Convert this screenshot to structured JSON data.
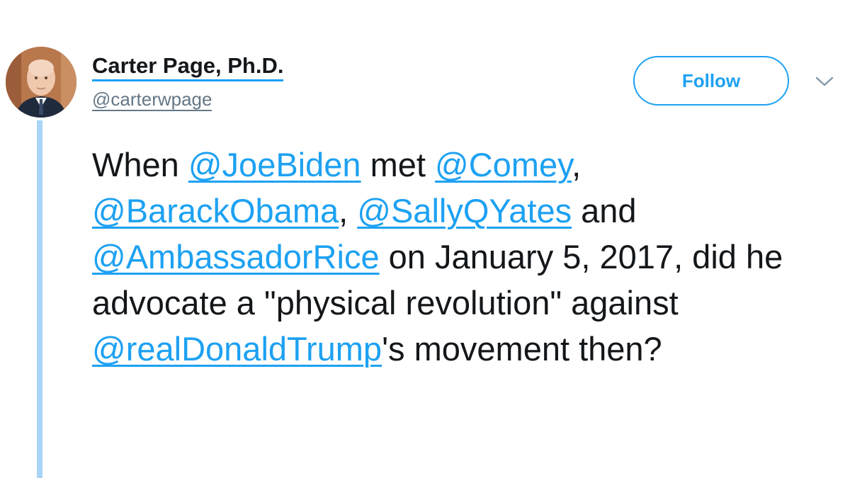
{
  "author": {
    "name": "Carter Page, Ph.D.",
    "handle": "@carterwpage"
  },
  "actions": {
    "follow_label": "Follow",
    "menu_icon": "chevron-down-icon"
  },
  "tweet": {
    "segments": [
      {
        "text": "When ",
        "mention": false
      },
      {
        "text": "@JoeBiden",
        "mention": true
      },
      {
        "text": " met ",
        "mention": false
      },
      {
        "text": "@Comey",
        "mention": true
      },
      {
        "text": ", ",
        "mention": false
      },
      {
        "text": "@BarackObama",
        "mention": true
      },
      {
        "text": ", ",
        "mention": false
      },
      {
        "text": "@SallyQYates",
        "mention": true
      },
      {
        "text": " and ",
        "mention": false
      },
      {
        "text": "@AmbassadorRice",
        "mention": true
      },
      {
        "text": " on January 5, 2017, did he advocate a \"physical revolution\" against ",
        "mention": false
      },
      {
        "text": "@realDonaldTrump",
        "mention": true
      },
      {
        "text": "'s movement then?",
        "mention": false
      }
    ]
  },
  "colors": {
    "accent": "#1da1f2",
    "thread_line": "#a8d5f7",
    "text": "#14171a",
    "secondary": "#657786"
  }
}
